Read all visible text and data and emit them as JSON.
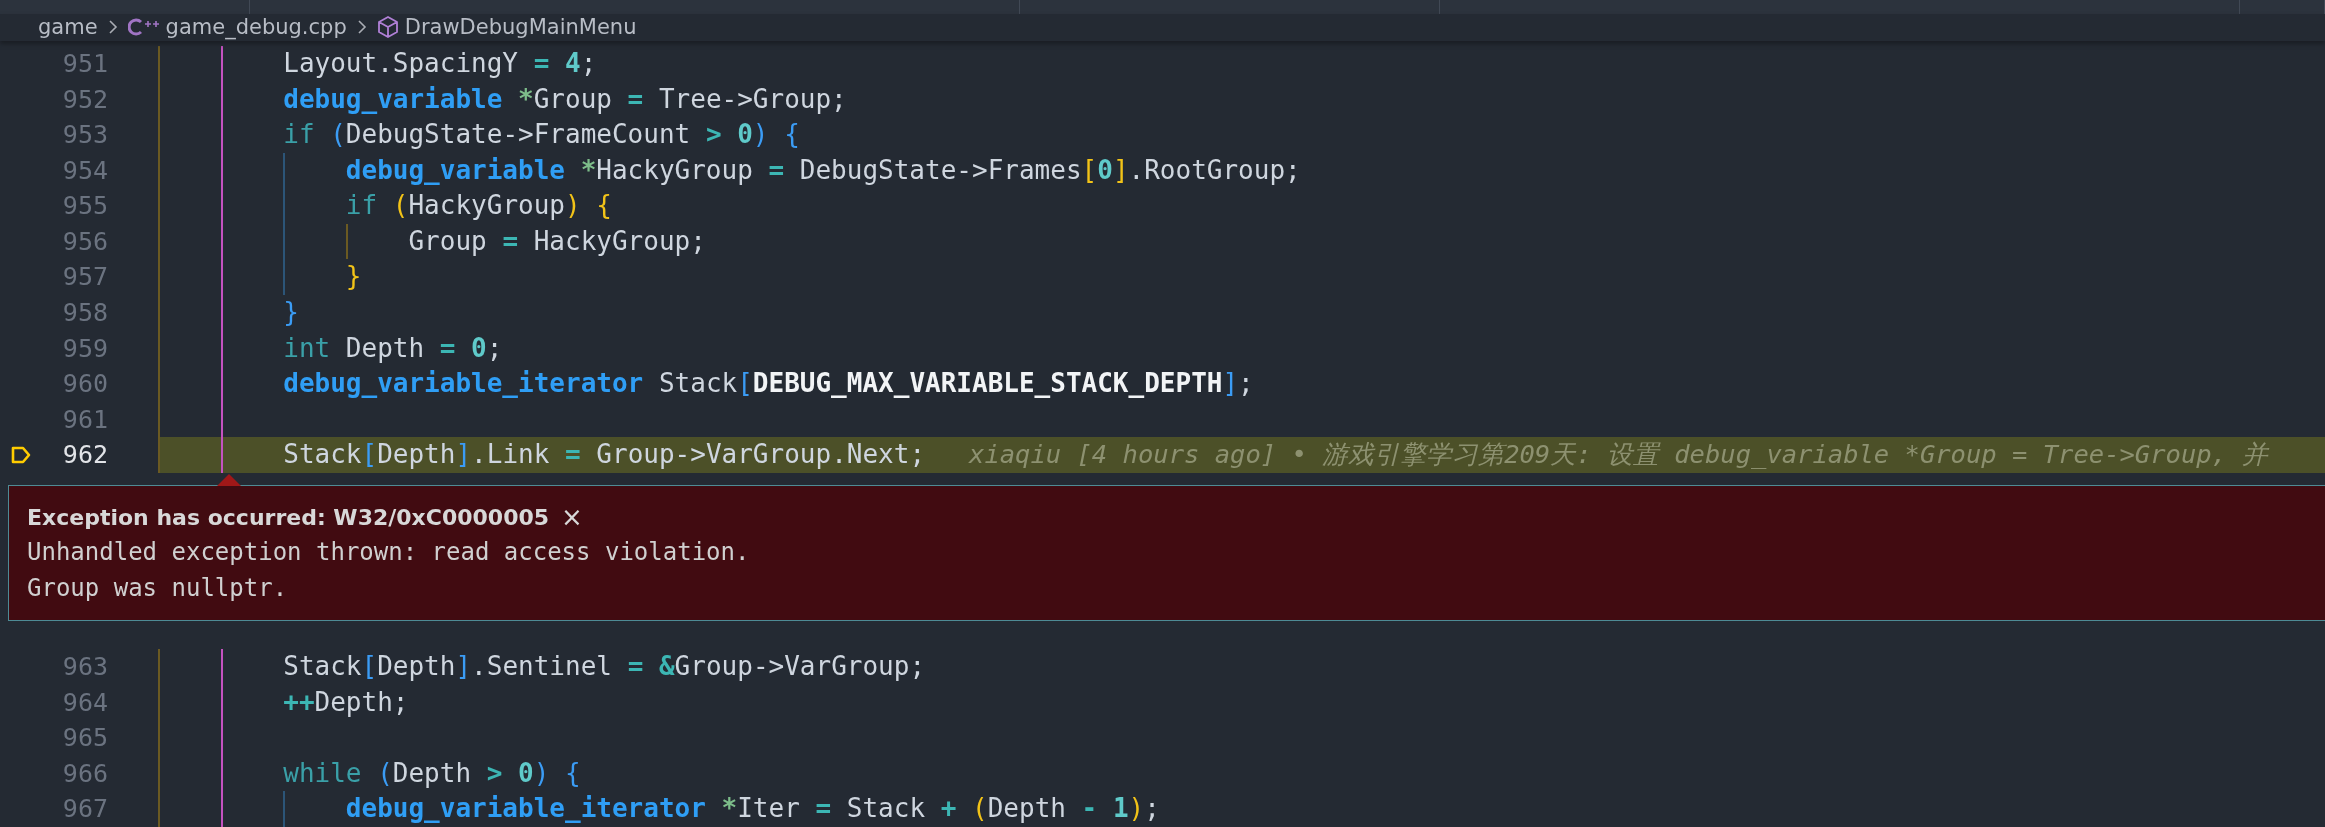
{
  "breadcrumb": [
    {
      "kind": "folder",
      "label": "game"
    },
    {
      "kind": "file",
      "label": "game_debug.cpp"
    },
    {
      "kind": "symbol",
      "label": "DrawDebugMainMenu"
    }
  ],
  "lines": [
    {
      "number": "951",
      "current": false,
      "tokens": [
        {
          "kind": "ident",
          "text": "        Layout.SpacingY "
        },
        {
          "kind": "op",
          "text": "= "
        },
        {
          "kind": "number",
          "text": "4"
        },
        {
          "kind": "ident",
          "text": ";"
        }
      ]
    },
    {
      "number": "952",
      "current": false,
      "tokens": [
        {
          "kind": "type",
          "text": "        debug_variable "
        },
        {
          "kind": "ptr",
          "text": "*"
        },
        {
          "kind": "ident",
          "text": "Group "
        },
        {
          "kind": "op",
          "text": "="
        },
        {
          "kind": "ident",
          "text": " Tree->Group;"
        }
      ]
    },
    {
      "number": "953",
      "current": false,
      "tokens": [
        {
          "kind": "keyword",
          "text": "        if "
        },
        {
          "kind": "paren1",
          "text": "("
        },
        {
          "kind": "ident",
          "text": "DebugState->FrameCount "
        },
        {
          "kind": "op",
          "text": "> "
        },
        {
          "kind": "number",
          "text": "0"
        },
        {
          "kind": "paren1",
          "text": ") {"
        }
      ]
    },
    {
      "number": "954",
      "current": false,
      "tokens": [
        {
          "kind": "type",
          "text": "            debug_variable "
        },
        {
          "kind": "ptr",
          "text": "*"
        },
        {
          "kind": "ident",
          "text": "HackyGroup "
        },
        {
          "kind": "op",
          "text": "="
        },
        {
          "kind": "ident",
          "text": " DebugState->Frames"
        },
        {
          "kind": "paren2",
          "text": "["
        },
        {
          "kind": "number",
          "text": "0"
        },
        {
          "kind": "paren2",
          "text": "]"
        },
        {
          "kind": "ident",
          "text": ".RootGroup;"
        }
      ]
    },
    {
      "number": "955",
      "current": false,
      "tokens": [
        {
          "kind": "keyword",
          "text": "            if "
        },
        {
          "kind": "paren2",
          "text": "("
        },
        {
          "kind": "ident",
          "text": "HackyGroup"
        },
        {
          "kind": "paren2",
          "text": ") {"
        }
      ]
    },
    {
      "number": "956",
      "current": false,
      "tokens": [
        {
          "kind": "ident",
          "text": "                Group "
        },
        {
          "kind": "op",
          "text": "="
        },
        {
          "kind": "ident",
          "text": " HackyGroup;"
        }
      ]
    },
    {
      "number": "957",
      "current": false,
      "tokens": [
        {
          "kind": "paren2",
          "text": "            }"
        }
      ]
    },
    {
      "number": "958",
      "current": false,
      "tokens": [
        {
          "kind": "paren1",
          "text": "        }"
        }
      ]
    },
    {
      "number": "959",
      "current": false,
      "tokens": [
        {
          "kind": "keyword",
          "text": "        int"
        },
        {
          "kind": "ident",
          "text": " Depth "
        },
        {
          "kind": "op",
          "text": "= "
        },
        {
          "kind": "number",
          "text": "0"
        },
        {
          "kind": "ident",
          "text": ";"
        }
      ]
    },
    {
      "number": "960",
      "current": false,
      "tokens": [
        {
          "kind": "type",
          "text": "        debug_variable_iterator"
        },
        {
          "kind": "ident",
          "text": " Stack"
        },
        {
          "kind": "paren1",
          "text": "["
        },
        {
          "kind": "macro",
          "text": "DEBUG_MAX_VARIABLE_STACK_DEPTH"
        },
        {
          "kind": "paren1",
          "text": "]"
        },
        {
          "kind": "ident",
          "text": ";"
        }
      ]
    },
    {
      "number": "961",
      "current": false
    },
    {
      "number": "962",
      "current": true,
      "tokens": [
        {
          "kind": "ident",
          "text": "        Stack"
        },
        {
          "kind": "paren1",
          "text": "["
        },
        {
          "kind": "ident",
          "text": "Depth"
        },
        {
          "kind": "paren1",
          "text": "]"
        },
        {
          "kind": "ident",
          "text": ".Link "
        },
        {
          "kind": "op",
          "text": "="
        },
        {
          "kind": "ident",
          "text": " Group->VarGroup.Next;"
        }
      ],
      "blame": "xiaqiu [4 hours ago] • 游戏引擎学习第209天: 设置 debug_variable *Group = Tree->Group, 并",
      "exception": {
        "title": "Exception has occurred: W32/0xC0000005",
        "close": "×",
        "message": [
          "Unhandled exception thrown: read access violation.",
          "Group was nullptr."
        ]
      }
    },
    {
      "number": "963",
      "current": false,
      "tokens": [
        {
          "kind": "ident",
          "text": "        Stack"
        },
        {
          "kind": "paren1",
          "text": "["
        },
        {
          "kind": "ident",
          "text": "Depth"
        },
        {
          "kind": "paren1",
          "text": "]"
        },
        {
          "kind": "ident",
          "text": ".Sentinel "
        },
        {
          "kind": "op",
          "text": "= &"
        },
        {
          "kind": "ident",
          "text": "Group->VarGroup;"
        }
      ]
    },
    {
      "number": "964",
      "current": false,
      "tokens": [
        {
          "kind": "op",
          "text": "        ++"
        },
        {
          "kind": "ident",
          "text": "Depth;"
        }
      ]
    },
    {
      "number": "965",
      "current": false
    },
    {
      "number": "966",
      "current": false,
      "tokens": [
        {
          "kind": "keyword",
          "text": "        while "
        },
        {
          "kind": "paren1",
          "text": "("
        },
        {
          "kind": "ident",
          "text": "Depth "
        },
        {
          "kind": "op",
          "text": "> "
        },
        {
          "kind": "number",
          "text": "0"
        },
        {
          "kind": "paren1",
          "text": ") {"
        }
      ]
    },
    {
      "number": "967",
      "current": false,
      "tokens": [
        {
          "kind": "type",
          "text": "            debug_variable_iterator "
        },
        {
          "kind": "ptr",
          "text": "*"
        },
        {
          "kind": "ident",
          "text": "Iter "
        },
        {
          "kind": "op",
          "text": "="
        },
        {
          "kind": "ident",
          "text": " Stack "
        },
        {
          "kind": "op",
          "text": "+ "
        },
        {
          "kind": "paren2",
          "text": "("
        },
        {
          "kind": "ident",
          "text": "Depth "
        },
        {
          "kind": "op",
          "text": "- "
        },
        {
          "kind": "number",
          "text": "1"
        },
        {
          "kind": "paren2",
          "text": ")"
        },
        {
          "kind": "ident",
          "text": ";"
        }
      ]
    }
  ]
}
